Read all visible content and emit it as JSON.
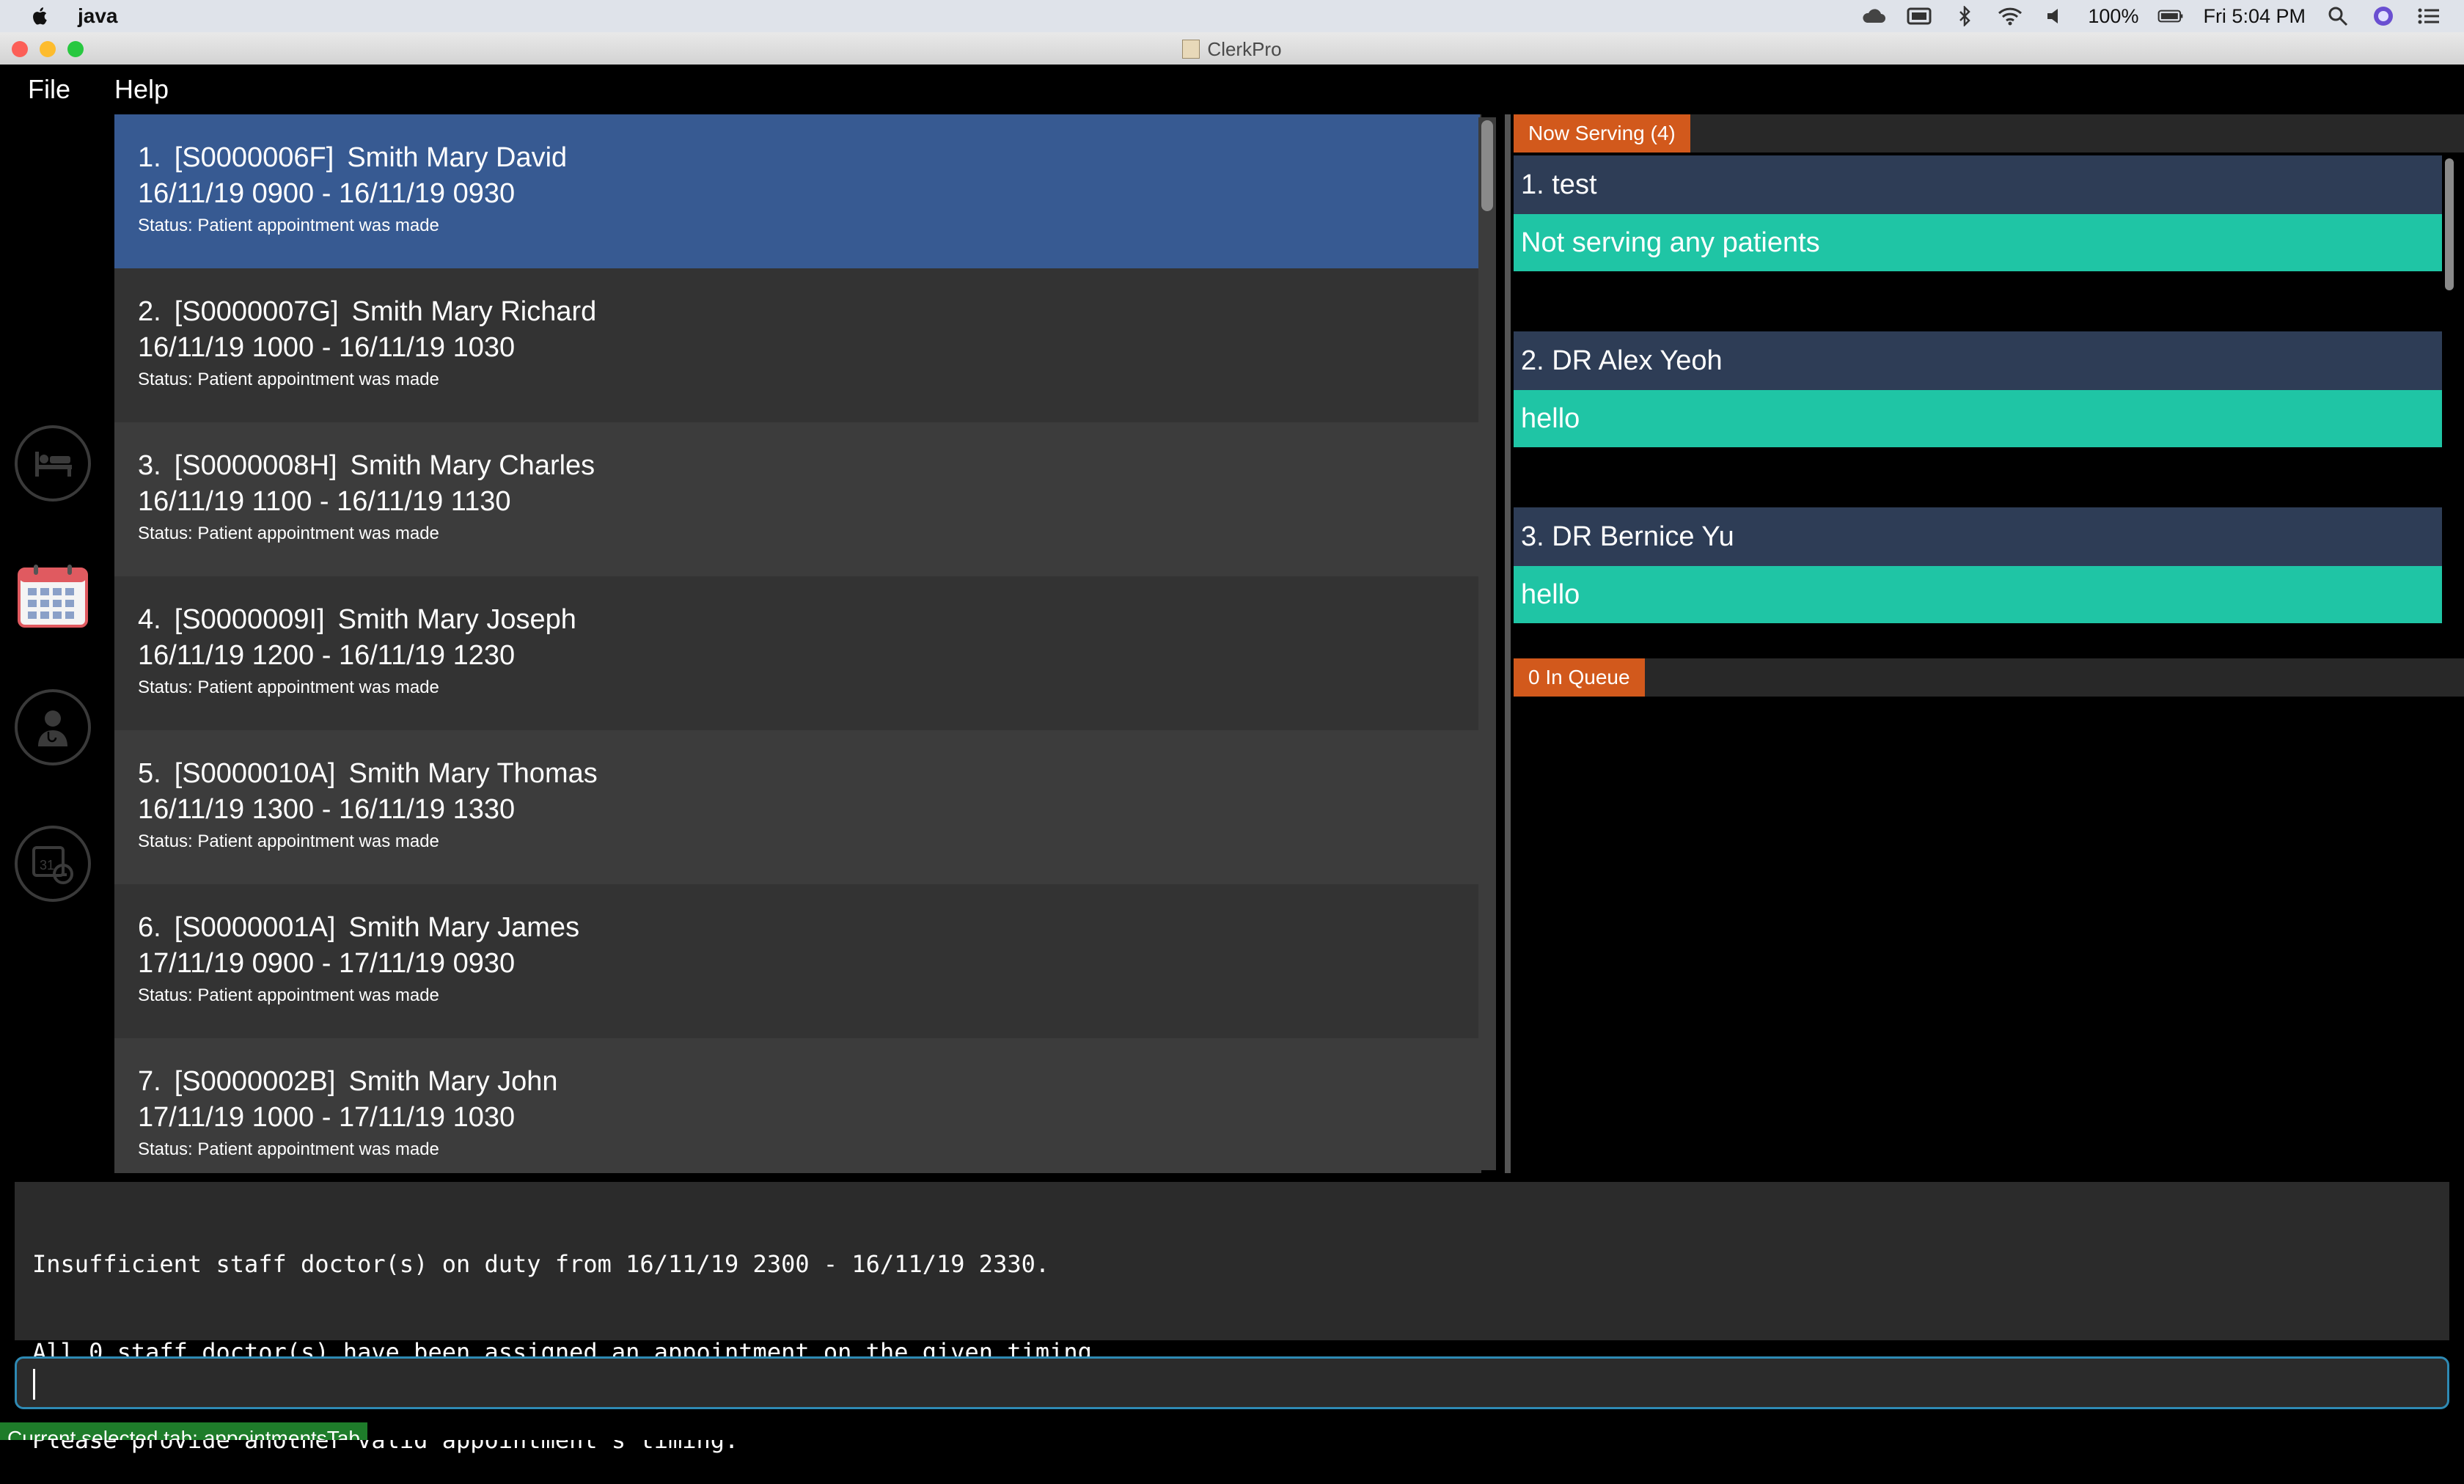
{
  "menubar": {
    "app_name": "java",
    "battery": "100%",
    "clock": "Fri 5:04 PM"
  },
  "window": {
    "title": "ClerkPro",
    "menu": [
      "File",
      "Help"
    ]
  },
  "sidebar": {
    "tabs": [
      "patients-tab",
      "appointments-tab",
      "doctors-tab",
      "duty-roster-tab"
    ],
    "selected": "appointments-tab"
  },
  "appointments": [
    {
      "index": "1.",
      "ref": "[S0000006F]",
      "name": "Smith Mary David",
      "time": "16/11/19 0900 - 16/11/19 0930",
      "status": "Status: Patient appointment was made"
    },
    {
      "index": "2.",
      "ref": "[S0000007G]",
      "name": "Smith Mary Richard",
      "time": "16/11/19 1000 - 16/11/19 1030",
      "status": "Status: Patient appointment was made"
    },
    {
      "index": "3.",
      "ref": "[S0000008H]",
      "name": "Smith Mary Charles",
      "time": "16/11/19 1100 - 16/11/19 1130",
      "status": "Status: Patient appointment was made"
    },
    {
      "index": "4.",
      "ref": "[S0000009I]",
      "name": "Smith Mary Joseph",
      "time": "16/11/19 1200 - 16/11/19 1230",
      "status": "Status: Patient appointment was made"
    },
    {
      "index": "5.",
      "ref": "[S0000010A]",
      "name": "Smith Mary Thomas",
      "time": "16/11/19 1300 - 16/11/19 1330",
      "status": "Status: Patient appointment was made"
    },
    {
      "index": "6.",
      "ref": "[S0000001A]",
      "name": "Smith Mary James",
      "time": "17/11/19 0900 - 17/11/19 0930",
      "status": "Status: Patient appointment was made"
    },
    {
      "index": "7.",
      "ref": "[S0000002B]",
      "name": "Smith Mary John",
      "time": "17/11/19 1000 - 17/11/19 1030",
      "status": "Status: Patient appointment was made"
    }
  ],
  "now_serving": {
    "label": "Now Serving (4)",
    "rooms": [
      {
        "title": "1. test",
        "serving": "Not serving any patients"
      },
      {
        "title": "2. DR Alex Yeoh",
        "serving": "hello"
      },
      {
        "title": "3. DR Bernice Yu",
        "serving": "hello"
      }
    ]
  },
  "queue": {
    "label": "0 In Queue"
  },
  "result_display": {
    "lines": [
      "Insufficient staff doctor(s) on duty from 16/11/19 2300 - 16/11/19 2330.",
      "All 0 staff doctor(s) have been assigned an appointment on the given timing.",
      "Please provide another valid appointment's timing."
    ]
  },
  "command_box": {
    "value": ""
  },
  "status_bar": {
    "text": "Current selected tab: appointmentsTab"
  },
  "colors": {
    "selected_card": "#375a92",
    "room_header": "#2e3d56",
    "room_body": "#1fc5a5",
    "section_tab": "#d2591c",
    "command_border": "#2e8ab4",
    "status_green": "#1e7c2a"
  }
}
